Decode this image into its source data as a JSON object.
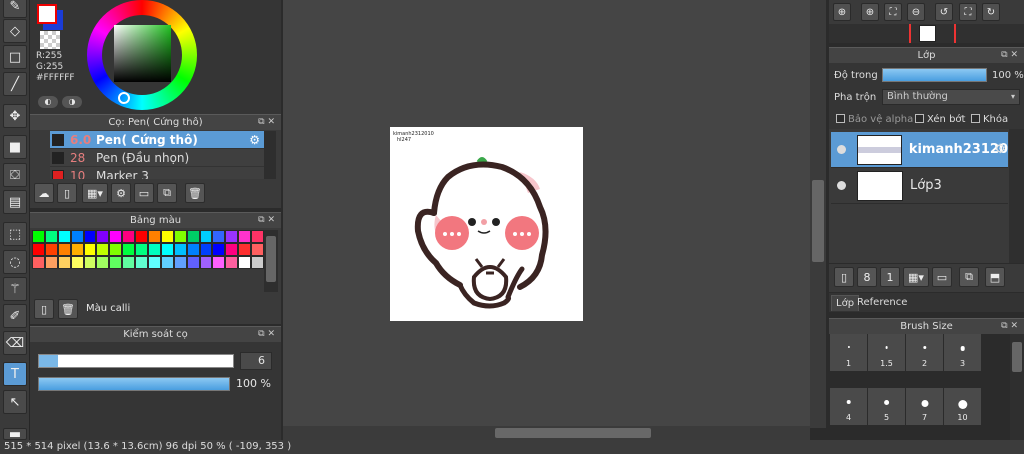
{
  "color": {
    "r_label": "R:255",
    "g_label": "G:255",
    "hex_label": "#FFFFFF",
    "foreground": "#ffffff",
    "background": "#1a3cd8"
  },
  "brush_panel": {
    "title": "Cọ: Pen( Cứng thô)",
    "items": [
      {
        "size": "6.0",
        "name": "Pen( Cứng thô)",
        "color": "#222222",
        "selected": true
      },
      {
        "size": "28",
        "name": "Pen (Đầu nhọn)",
        "color": "#222222",
        "selected": false
      },
      {
        "size": "10",
        "name": "Marker 3",
        "color": "#e02020",
        "selected": false
      }
    ]
  },
  "palette_panel": {
    "title": "Bảng màu",
    "colors": [
      "#00ff00",
      "#00ff80",
      "#00ffff",
      "#0080ff",
      "#0000ff",
      "#8000ff",
      "#ff00ff",
      "#ff0080",
      "#ff0000",
      "#ff8000",
      "#ffff00",
      "#80ff00",
      "#00cc66",
      "#00ccff",
      "#3366ff",
      "#9933ff",
      "#ff33cc",
      "#ff3366",
      "#ff0000",
      "#ff4000",
      "#ff8000",
      "#ffb000",
      "#ffff00",
      "#c0ff00",
      "#80ff00",
      "#00ff40",
      "#00ff80",
      "#00ffc0",
      "#00ffff",
      "#00c0ff",
      "#0080ff",
      "#0040ff",
      "#0000ff",
      "#ff0080",
      "#ff3030",
      "#ff6060",
      "#ff6060",
      "#ffa060",
      "#ffd060",
      "#ffff60",
      "#d0ff60",
      "#a0ff60",
      "#60ff60",
      "#60ffa0",
      "#60ffd0",
      "#60ffff",
      "#60d0ff",
      "#60a0ff",
      "#6060ff",
      "#a060ff",
      "#ff60ff",
      "#ff60a0",
      "#ffffff",
      "#cccccc"
    ],
    "footer_label": "Màu calli"
  },
  "brush_control": {
    "title": "Kiểm soát cọ",
    "size_value": "6",
    "opacity_value": "100 %",
    "size_fraction": 0.1,
    "opacity_fraction": 1.0
  },
  "canvas": {
    "watermark_line1": "kimanh2312010",
    "watermark_line2": "hl247"
  },
  "status": {
    "text": "515 * 514 pixel   (13.6 * 13.6cm)   96 dpi   50 %   ( -109, 353 )"
  },
  "layer_panel": {
    "title": "Lớp",
    "opacity_label": "Độ trong",
    "opacity_value": "100 %",
    "blend_label": "Pha trộn",
    "blend_value": "Bình thường",
    "protect_alpha_label": "Bảo vệ alpha",
    "clip_label": "Xén bớt",
    "lock_label": "Khóa",
    "layers": [
      {
        "name": "kimanh23120",
        "selected": true
      },
      {
        "name": "Lớp3",
        "selected": false
      }
    ]
  },
  "tabs": [
    "Lớp",
    "Reference"
  ],
  "brush_size_panel": {
    "title": "Brush Size",
    "sizes": [
      {
        "label": "1",
        "dot": 1
      },
      {
        "label": "1.5",
        "dot": 1.5
      },
      {
        "label": "2",
        "dot": 2
      },
      {
        "label": "3",
        "dot": 3
      },
      {
        "label": "4",
        "dot": 3
      },
      {
        "label": "5",
        "dot": 4
      },
      {
        "label": "7",
        "dot": 5
      },
      {
        "label": "10",
        "dot": 7
      }
    ]
  }
}
